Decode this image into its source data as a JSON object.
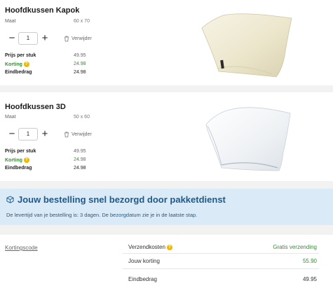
{
  "products": [
    {
      "name": "Hoofdkussen Kapok",
      "size_label": "Maat",
      "size_value": "60 x 70",
      "quantity": "1",
      "minus": "−",
      "plus": "+",
      "remove_label": "Verwijder",
      "price_label": "Prijs per stuk",
      "price_value": "49.95",
      "discount_label": "Korting",
      "discount_value": "24.98",
      "total_label": "Eindbedrag",
      "total_value": "24.98"
    },
    {
      "name": "Hoofdkussen 3D",
      "size_label": "Maat",
      "size_value": "50 x 60",
      "quantity": "1",
      "minus": "−",
      "plus": "+",
      "remove_label": "Verwijder",
      "price_label": "Prijs per stuk",
      "price_value": "49.95",
      "discount_label": "Korting",
      "discount_value": "24.98",
      "total_label": "Eindbedrag",
      "total_value": "24.98"
    }
  ],
  "delivery": {
    "title": "Jouw bestelling snel bezorgd door pakketdienst",
    "text": "De levertijd van je bestelling is: 3 dagen. De bezorgdatum zie je in de laatste stap."
  },
  "summary": {
    "discount_code_link": "Kortingscode",
    "shipping_label": "Verzendkosten",
    "shipping_value": "Gratis verzending",
    "discount_label": "Jouw korting",
    "discount_value": "55.90",
    "total_label": "Eindbedrag",
    "total_value": "49.95"
  },
  "info_icon_glyph": "?",
  "colors": {
    "green": "#3a8a3a",
    "info_yellow": "#f0b800",
    "delivery_bg": "#dbeaf7",
    "delivery_text": "#1d5a8a"
  }
}
